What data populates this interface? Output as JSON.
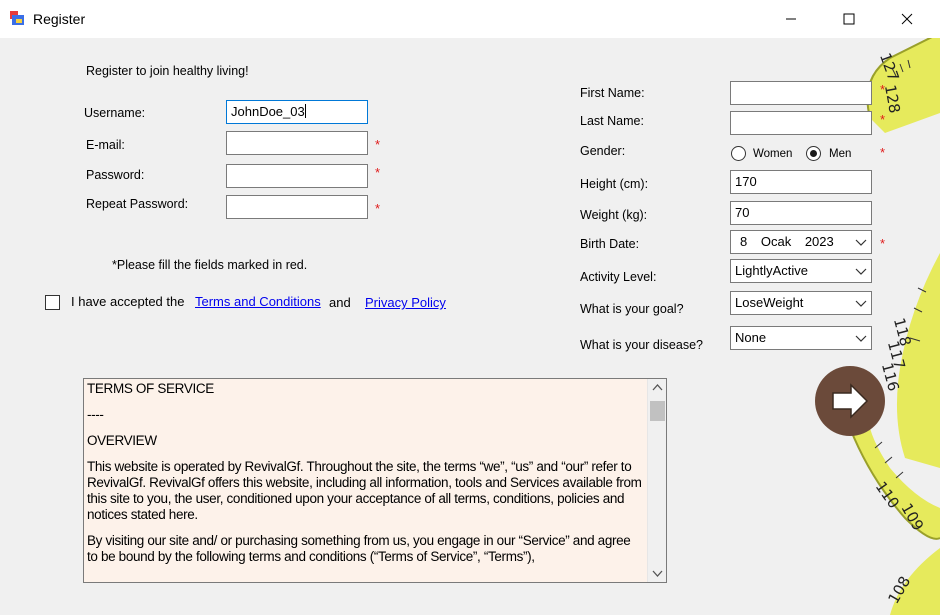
{
  "window": {
    "title": "Register",
    "app_icon": "app-window-icon",
    "controls": [
      "minimize-icon",
      "maximize-icon",
      "close-icon"
    ]
  },
  "left": {
    "heading": "Register to join healthy living!",
    "username_label": "Username:",
    "username_value": "JohnDoe_03",
    "email_label": "E-mail:",
    "email_value": "",
    "password_label": "Password:",
    "password_value": "",
    "repeat_password_label": "Repeat Password:",
    "repeat_password_value": "",
    "required_note": "*Please fill the fields marked in red.",
    "accept_text": "I have accepted the",
    "terms_link": "Terms and Conditions",
    "and_text": "and",
    "privacy_link": "Privacy Policy",
    "terms_accepted": false
  },
  "right": {
    "first_name_label": "First Name:",
    "first_name_value": "",
    "last_name_label": "Last Name:",
    "last_name_value": "",
    "gender_label": "Gender:",
    "gender_women": "Women",
    "gender_men": "Men",
    "gender_selected": "Men",
    "height_label": "Height (cm):",
    "height_value": "170",
    "weight_label": "Weight (kg):",
    "weight_value": "70",
    "birth_date_label": "Birth Date:",
    "birth_day": "8",
    "birth_month": "Ocak",
    "birth_year": "2023",
    "activity_label": "Activity Level:",
    "activity_value": "LightlyActive",
    "goal_label": "What is your goal?",
    "goal_value": "LoseWeight",
    "disease_label": "What is your disease?",
    "disease_value": "None"
  },
  "required_mark": "*",
  "terms": {
    "title": "TERMS OF SERVICE",
    "separator": "----",
    "overview": "OVERVIEW",
    "para1": "This website is operated by RevivalGf. Throughout the site, the terms “we”, “us” and “our” refer to RevivalGf. RevivalGf offers this website, including all information, tools and Services available from this site to you, the user, conditioned upon your acceptance of all terms, conditions, policies and notices stated here.",
    "para2": "By visiting our site and/ or purchasing something from us, you engage in our “Service” and agree to be bound by the following terms and conditions (“Terms of Service”, “Terms”),"
  },
  "tape_numbers": [
    "128",
    "127",
    "118",
    "117",
    "116",
    "110",
    "109",
    "108"
  ],
  "colors": {
    "required": "#e01a1a",
    "link": "#0000ee",
    "focus_border": "#0078d7",
    "terms_background": "#fdf2ea",
    "next_button": "#6b4a3a",
    "tape": "#e6ea5c"
  }
}
